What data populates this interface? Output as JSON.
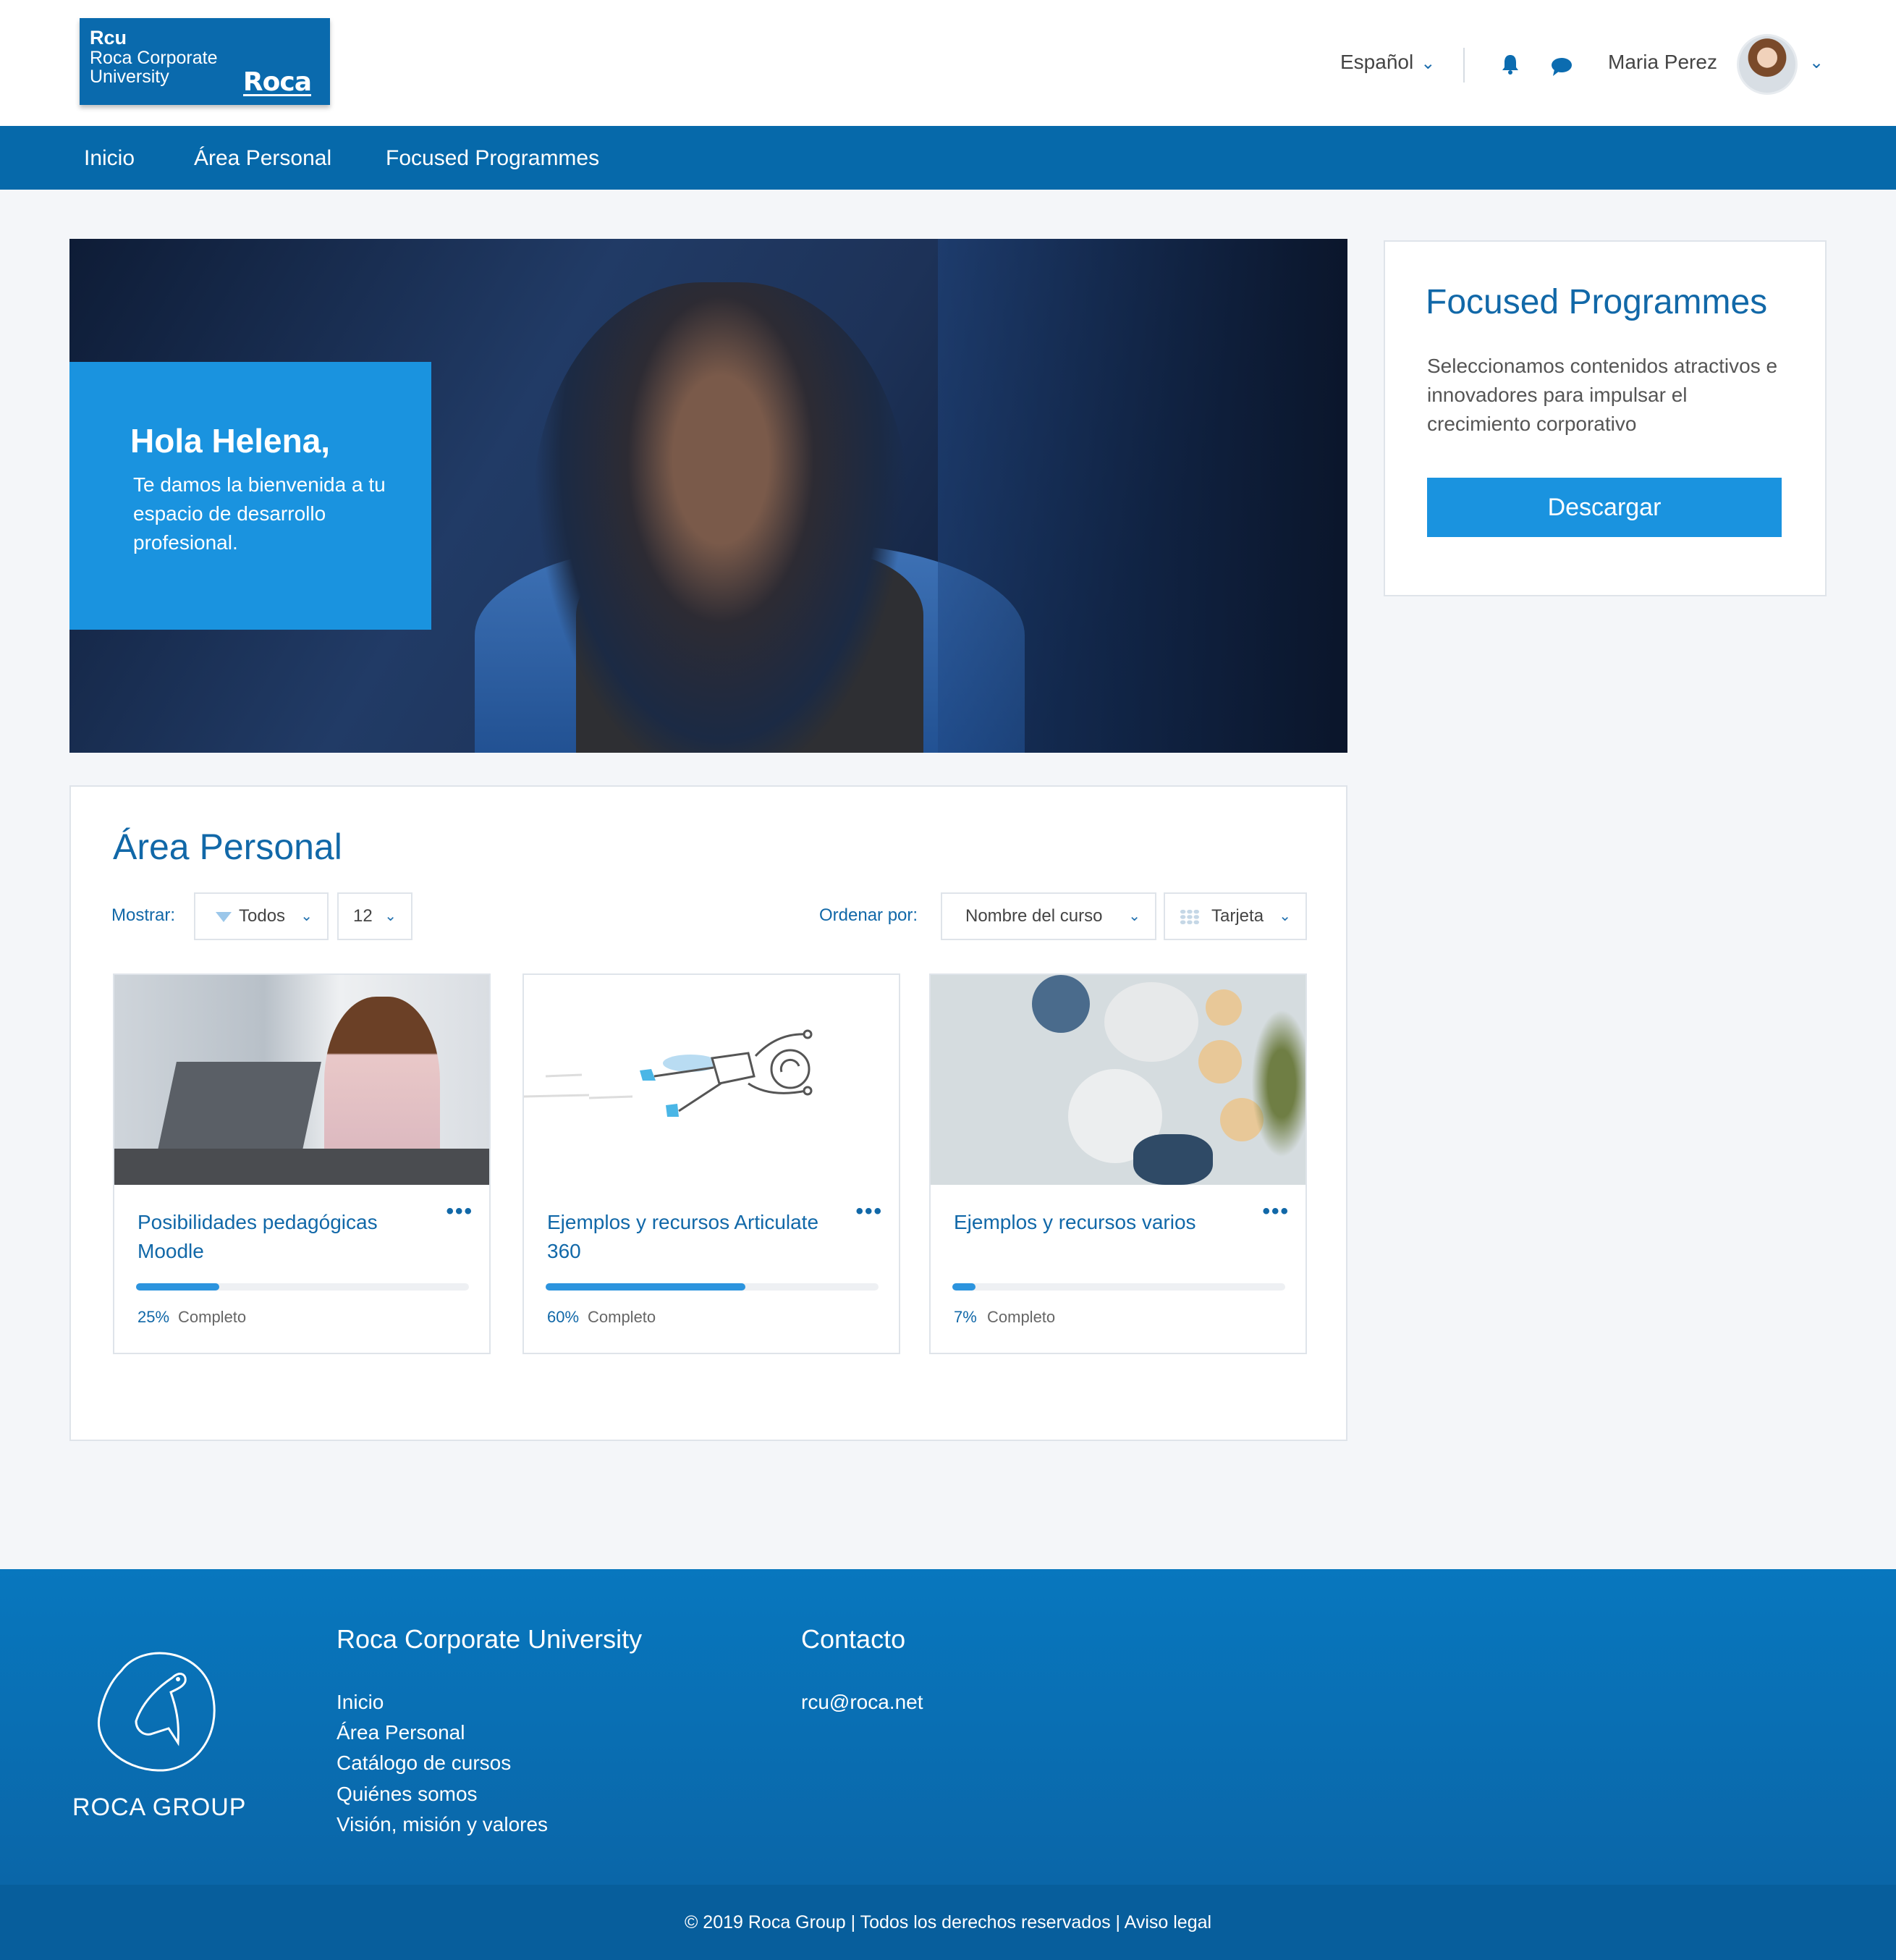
{
  "header": {
    "logo": {
      "line1": "Rcu",
      "line2": "Roca Corporate",
      "line3": "University",
      "brand": "Roca"
    },
    "language": "Español",
    "user_name": "Maria Perez",
    "icons": [
      "bell-icon",
      "chat-icon",
      "chevron-down-icon"
    ]
  },
  "nav": {
    "items": [
      {
        "label": "Inicio"
      },
      {
        "label": "Área Personal"
      },
      {
        "label": "Focused Programmes"
      }
    ]
  },
  "hero": {
    "greeting": "Hola Helena,",
    "subtitle": "Te damos la bienvenida a tu espacio de desarrollo profesional."
  },
  "side_card": {
    "title": "Focused Programmes",
    "text": "Seleccionamos contenidos atractivos e innovadores para impulsar el crecimiento corporativo",
    "button": "Descargar"
  },
  "area": {
    "title": "Área Personal",
    "show_label": "Mostrar:",
    "filter_value": "Todos",
    "count_value": "12",
    "sort_label": "Ordenar por:",
    "sort_value": "Nombre del curso",
    "view_value": "Tarjeta",
    "cards": [
      {
        "title": "Posibilidades pedagógicas Moodle",
        "percent": "25%",
        "progress": 0.25,
        "status": "Completo"
      },
      {
        "title": "Ejemplos y recursos Articulate 360",
        "percent": "60%",
        "progress": 0.6,
        "status": "Completo"
      },
      {
        "title": "Ejemplos y recursos varios",
        "percent": "7%",
        "progress": 0.07,
        "status": "Completo"
      }
    ],
    "more_symbol": "•••"
  },
  "footer": {
    "brand": "ROCA GROUP",
    "col1_title": "Roca Corporate University",
    "col1_links": [
      "Inicio",
      "Área Personal",
      "Catálogo de cursos",
      "Quiénes somos",
      "Visión, misión y valores"
    ],
    "col2_title": "Contacto",
    "col2_email": "rcu@roca.net",
    "copyright": "© 2019 Roca Group | Todos los derechos reservados | Aviso legal"
  },
  "colors": {
    "primary": "#0669aa",
    "accent": "#1a93df",
    "link": "#1168a8",
    "background": "#f4f6f9"
  }
}
